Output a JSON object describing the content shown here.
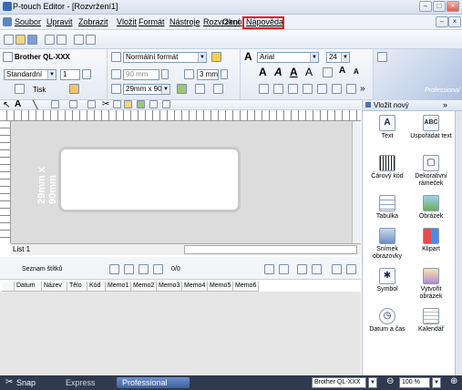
{
  "window": {
    "title": "P-touch Editor - [Rozvržení1]"
  },
  "menu": {
    "items": [
      "Soubor",
      "Upravit",
      "Zobrazit",
      "Vložit",
      "Formát",
      "Nástroje",
      "Rozvržení",
      "Okno",
      "Nápověda"
    ],
    "highlighted": "Nápověda"
  },
  "toolbar_print": {
    "printer": "Brother QL-XXX",
    "mode_value": "Standardní",
    "copies_value": "1",
    "print_label": "Tisk"
  },
  "toolbar_paper": {
    "format_value": "Normální formát",
    "length_value": "90 mm",
    "margin_value": "3 mm",
    "tape_value": "29mm x 90m"
  },
  "toolbar_font": {
    "font_value": "Arial",
    "size_value": "24"
  },
  "toolbar_right": {
    "label": "Professional"
  },
  "canvas": {
    "label_size": "29mm x 90mm",
    "sheet_tab": "List 1"
  },
  "label_list": {
    "title": "Seznam štítků",
    "page_counter": "0/0",
    "columns": [
      "Datum",
      "Název",
      "Tělo",
      "Kód",
      "Memo1",
      "Memo2",
      "Memo3",
      "Memo4",
      "Memo5",
      "Memo6"
    ]
  },
  "right_panel": {
    "header": "Vložit nový",
    "more_label": "»",
    "items": [
      {
        "label": "Text",
        "icon": "text-A-icon"
      },
      {
        "label": "Uspořádat text",
        "icon": "arrange-text-icon"
      },
      {
        "label": "Čárový kód",
        "icon": "barcode-icon"
      },
      {
        "label": "Dekorativní rámeček",
        "icon": "frame-icon"
      },
      {
        "label": "Tabulka",
        "icon": "table-icon"
      },
      {
        "label": "Obrázek",
        "icon": "picture-icon"
      },
      {
        "label": "Snímek obrazovky",
        "icon": "screenshot-icon"
      },
      {
        "label": "Klipart",
        "icon": "clipart-icon"
      },
      {
        "label": "Symbol",
        "icon": "symbol-icon"
      },
      {
        "label": "Vytvořit obrázek",
        "icon": "make-image-icon"
      },
      {
        "label": "Datum a čas",
        "icon": "clock-icon"
      },
      {
        "label": "Kalendář",
        "icon": "calendar-icon"
      }
    ]
  },
  "statusbar": {
    "snap_label": "Snap",
    "modes": [
      "Express",
      "Professional"
    ],
    "active_mode": "Professional",
    "printer_value": "Brother QL-XXX",
    "zoom_value": "100 %"
  },
  "colors": {
    "highlight_box": "#e8141b",
    "status_bar": "#2f3a4f",
    "active_mode": "#3d5f9b"
  }
}
